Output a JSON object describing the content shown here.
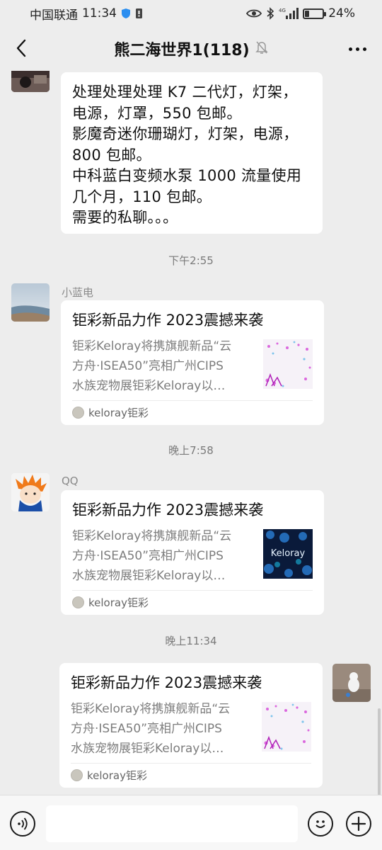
{
  "status_bar": {
    "carrier": "中国联通",
    "time": "11:34",
    "network": "4G",
    "battery_percent": "24%",
    "battery_level": 0.24
  },
  "header": {
    "title": "熊二海世界1(118)",
    "muted": true
  },
  "messages": {
    "first_text": {
      "lines": [
        "处理处理处理 K7 二代灯，灯架，",
        "电源，灯罩，550 包邮。",
        "影魔奇迷你珊瑚灯，灯架，电源，",
        "800 包邮。",
        "中科蓝白变频水泵 1000 流量使用",
        "几个月，110 包邮。",
        "需要的私聊。。。"
      ]
    },
    "time1": "下午2:55",
    "card1": {
      "sender": "小蓝电",
      "title": "钜彩新品力作 2023震撼来袭",
      "desc": [
        "钜彩Keloray将携旗舰新品“云",
        "方舟·ISEA50”亮相广州CIPS",
        "水族宠物展钜彩Keloray以…"
      ],
      "source": "keloray钜彩"
    },
    "time2": "晚上7:58",
    "card2": {
      "sender": "QQ",
      "title": "钜彩新品力作 2023震撼来袭",
      "desc": [
        "钜彩Keloray将携旗舰新品“云",
        "方舟·ISEA50”亮相广州CIPS",
        "水族宠物展钜彩Keloray以…"
      ],
      "thumb_text": "Keloray",
      "source": "keloray钜彩"
    },
    "time3": "晚上11:34",
    "card3": {
      "title": "钜彩新品力作 2023震撼来袭",
      "desc": [
        "钜彩Keloray将携旗舰新品“云",
        "方舟·ISEA50”亮相广州CIPS",
        "水族宠物展钜彩Keloray以…"
      ],
      "source": "keloray钜彩"
    }
  },
  "input_bar": {
    "placeholder": ""
  },
  "icons": {
    "back": "chevron-left-icon",
    "mute": "bell-off-icon",
    "more": "more-icon",
    "voice": "voice-icon",
    "emoji": "emoji-icon",
    "add": "plus-icon"
  },
  "colors": {
    "background": "#ededed",
    "bubble": "#ffffff",
    "text": "#111111",
    "muted_text": "#7d7d7d"
  }
}
